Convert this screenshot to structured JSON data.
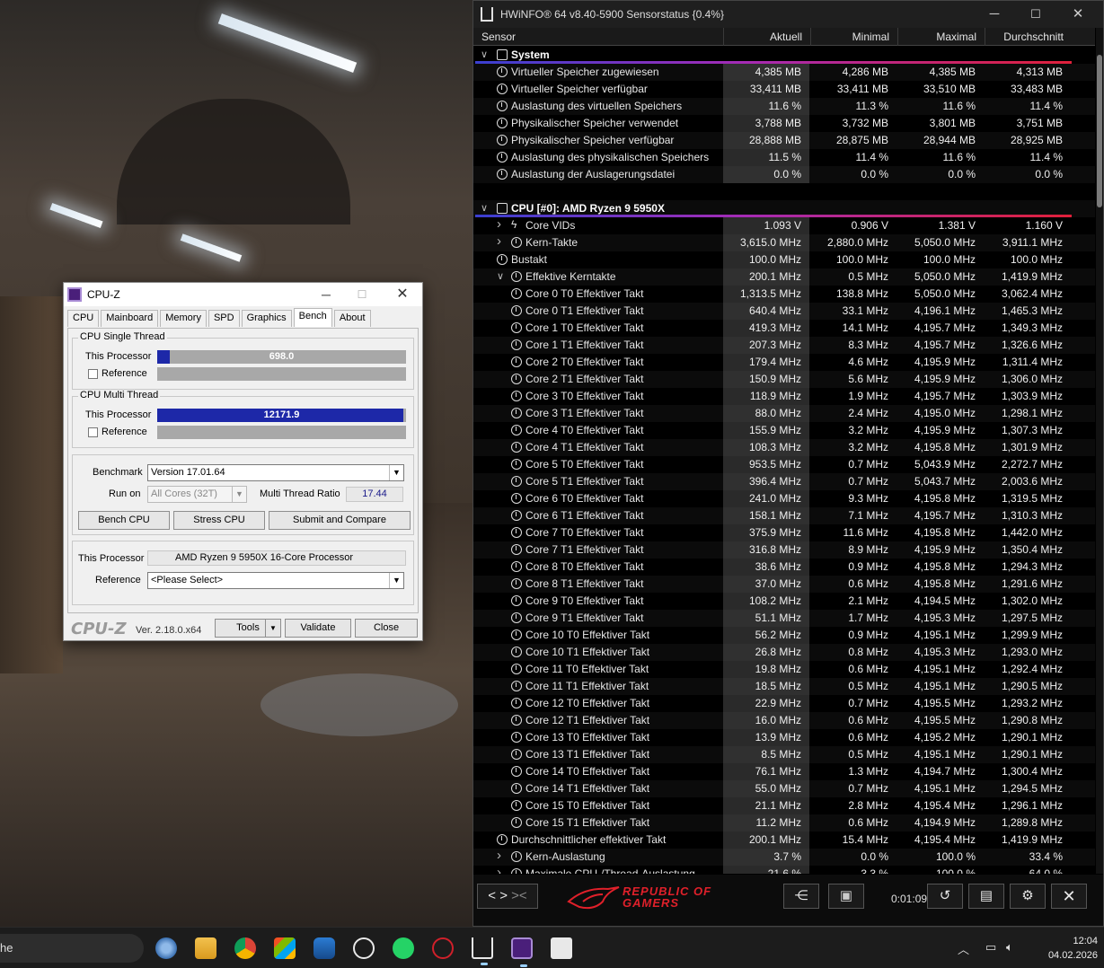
{
  "cpuz": {
    "title": "CPU-Z",
    "tabs": [
      "CPU",
      "Mainboard",
      "Memory",
      "SPD",
      "Graphics",
      "Bench",
      "About"
    ],
    "active_tab": "Bench",
    "single_thread": {
      "group_title": "CPU Single Thread",
      "this_label": "This Processor",
      "value": "698.0",
      "fill": 0.05,
      "reference_label": "Reference"
    },
    "multi_thread": {
      "group_title": "CPU Multi Thread",
      "this_label": "This Processor",
      "value": "12171.9",
      "fill": 0.99,
      "reference_label": "Reference"
    },
    "benchmark_label": "Benchmark",
    "benchmark_value": "Version 17.01.64",
    "run_on_label": "Run on",
    "run_on_value": "All Cores (32T)",
    "mt_ratio_label": "Multi Thread Ratio",
    "mt_ratio_value": "17.44",
    "btn_bench": "Bench CPU",
    "btn_stress": "Stress CPU",
    "btn_submit": "Submit and Compare",
    "this_processor_label": "This Processor",
    "this_processor_value": "AMD Ryzen 9 5950X 16-Core Processor",
    "reference_label": "Reference",
    "reference_value": "<Please Select>",
    "logo": "CPU-Z",
    "version": "Ver. 2.18.0.x64",
    "btn_tools": "Tools",
    "btn_validate": "Validate",
    "btn_close": "Close"
  },
  "hwinfo": {
    "title": "HWiNFO® 64 v8.40-5900 Sensorstatus {0.4%}",
    "columns": [
      "Sensor",
      "Aktuell",
      "Minimal",
      "Maximal",
      "Durchschnitt"
    ],
    "rows": [
      {
        "kind": "group",
        "label": "System",
        "values": [
          "",
          "",
          "",
          ""
        ]
      },
      {
        "kind": "clock",
        "indent": 1,
        "label": "Virtueller Speicher zugewiesen",
        "values": [
          "4,385 MB",
          "4,286 MB",
          "4,385 MB",
          "4,313 MB"
        ]
      },
      {
        "kind": "clock",
        "indent": 1,
        "label": "Virtueller Speicher verfügbar",
        "values": [
          "33,411 MB",
          "33,411 MB",
          "33,510 MB",
          "33,483 MB"
        ]
      },
      {
        "kind": "clock",
        "indent": 1,
        "label": "Auslastung des virtuellen Speichers",
        "values": [
          "11.6 %",
          "11.3 %",
          "11.6 %",
          "11.4 %"
        ]
      },
      {
        "kind": "clock",
        "indent": 1,
        "label": "Physikalischer Speicher verwendet",
        "values": [
          "3,788 MB",
          "3,732 MB",
          "3,801 MB",
          "3,751 MB"
        ]
      },
      {
        "kind": "clock",
        "indent": 1,
        "label": "Physikalischer Speicher verfügbar",
        "values": [
          "28,888 MB",
          "28,875 MB",
          "28,944 MB",
          "28,925 MB"
        ]
      },
      {
        "kind": "clock",
        "indent": 1,
        "label": "Auslastung des physikalischen Speichers",
        "values": [
          "11.5 %",
          "11.4 %",
          "11.6 %",
          "11.4 %"
        ]
      },
      {
        "kind": "clock",
        "indent": 1,
        "label": "Auslastung der Auslagerungsdatei",
        "values": [
          "0.0 %",
          "0.0 %",
          "0.0 %",
          "0.0 %"
        ]
      },
      {
        "kind": "blank",
        "label": "",
        "values": [
          "",
          "",
          "",
          ""
        ]
      },
      {
        "kind": "group",
        "label": "CPU [#0]: AMD Ryzen 9 5950X",
        "values": [
          "",
          "",
          "",
          ""
        ]
      },
      {
        "kind": "bolt",
        "indent": 2,
        "expand": "collapsed",
        "label": "Core VIDs",
        "values": [
          "1.093 V",
          "0.906 V",
          "1.381 V",
          "1.160 V"
        ]
      },
      {
        "kind": "clock",
        "indent": 2,
        "expand": "collapsed",
        "label": "Kern-Takte",
        "values": [
          "3,615.0 MHz",
          "2,880.0 MHz",
          "5,050.0 MHz",
          "3,911.1 MHz"
        ]
      },
      {
        "kind": "clock",
        "indent": 1,
        "label": "Bustakt",
        "values": [
          "100.0 MHz",
          "100.0 MHz",
          "100.0 MHz",
          "100.0 MHz"
        ]
      },
      {
        "kind": "clock",
        "indent": 2,
        "expand": "expanded",
        "label": "Effektive Kerntakte",
        "values": [
          "200.1 MHz",
          "0.5 MHz",
          "5,050.0 MHz",
          "1,419.9 MHz"
        ]
      },
      {
        "kind": "clock",
        "indent": 3,
        "label": "Core 0 T0 Effektiver Takt",
        "values": [
          "1,313.5 MHz",
          "138.8 MHz",
          "5,050.0 MHz",
          "3,062.4 MHz"
        ]
      },
      {
        "kind": "clock",
        "indent": 3,
        "label": "Core 0 T1 Effektiver Takt",
        "values": [
          "640.4 MHz",
          "33.1 MHz",
          "4,196.1 MHz",
          "1,465.3 MHz"
        ]
      },
      {
        "kind": "clock",
        "indent": 3,
        "label": "Core 1 T0 Effektiver Takt",
        "values": [
          "419.3 MHz",
          "14.1 MHz",
          "4,195.7 MHz",
          "1,349.3 MHz"
        ]
      },
      {
        "kind": "clock",
        "indent": 3,
        "label": "Core 1 T1 Effektiver Takt",
        "values": [
          "207.3 MHz",
          "8.3 MHz",
          "4,195.7 MHz",
          "1,326.6 MHz"
        ]
      },
      {
        "kind": "clock",
        "indent": 3,
        "label": "Core 2 T0 Effektiver Takt",
        "values": [
          "179.4 MHz",
          "4.6 MHz",
          "4,195.9 MHz",
          "1,311.4 MHz"
        ]
      },
      {
        "kind": "clock",
        "indent": 3,
        "label": "Core 2 T1 Effektiver Takt",
        "values": [
          "150.9 MHz",
          "5.6 MHz",
          "4,195.9 MHz",
          "1,306.0 MHz"
        ]
      },
      {
        "kind": "clock",
        "indent": 3,
        "label": "Core 3 T0 Effektiver Takt",
        "values": [
          "118.9 MHz",
          "1.9 MHz",
          "4,195.7 MHz",
          "1,303.9 MHz"
        ]
      },
      {
        "kind": "clock",
        "indent": 3,
        "label": "Core 3 T1 Effektiver Takt",
        "values": [
          "88.0 MHz",
          "2.4 MHz",
          "4,195.0 MHz",
          "1,298.1 MHz"
        ]
      },
      {
        "kind": "clock",
        "indent": 3,
        "label": "Core 4 T0 Effektiver Takt",
        "values": [
          "155.9 MHz",
          "3.2 MHz",
          "4,195.9 MHz",
          "1,307.3 MHz"
        ]
      },
      {
        "kind": "clock",
        "indent": 3,
        "label": "Core 4 T1 Effektiver Takt",
        "values": [
          "108.3 MHz",
          "3.2 MHz",
          "4,195.8 MHz",
          "1,301.9 MHz"
        ]
      },
      {
        "kind": "clock",
        "indent": 3,
        "label": "Core 5 T0 Effektiver Takt",
        "values": [
          "953.5 MHz",
          "0.7 MHz",
          "5,043.9 MHz",
          "2,272.7 MHz"
        ]
      },
      {
        "kind": "clock",
        "indent": 3,
        "label": "Core 5 T1 Effektiver Takt",
        "values": [
          "396.4 MHz",
          "0.7 MHz",
          "5,043.7 MHz",
          "2,003.6 MHz"
        ]
      },
      {
        "kind": "clock",
        "indent": 3,
        "label": "Core 6 T0 Effektiver Takt",
        "values": [
          "241.0 MHz",
          "9.3 MHz",
          "4,195.8 MHz",
          "1,319.5 MHz"
        ]
      },
      {
        "kind": "clock",
        "indent": 3,
        "label": "Core 6 T1 Effektiver Takt",
        "values": [
          "158.1 MHz",
          "7.1 MHz",
          "4,195.7 MHz",
          "1,310.3 MHz"
        ]
      },
      {
        "kind": "clock",
        "indent": 3,
        "label": "Core 7 T0 Effektiver Takt",
        "values": [
          "375.9 MHz",
          "11.6 MHz",
          "4,195.8 MHz",
          "1,442.0 MHz"
        ]
      },
      {
        "kind": "clock",
        "indent": 3,
        "label": "Core 7 T1 Effektiver Takt",
        "values": [
          "316.8 MHz",
          "8.9 MHz",
          "4,195.9 MHz",
          "1,350.4 MHz"
        ]
      },
      {
        "kind": "clock",
        "indent": 3,
        "label": "Core 8 T0 Effektiver Takt",
        "values": [
          "38.6 MHz",
          "0.9 MHz",
          "4,195.8 MHz",
          "1,294.3 MHz"
        ]
      },
      {
        "kind": "clock",
        "indent": 3,
        "label": "Core 8 T1 Effektiver Takt",
        "values": [
          "37.0 MHz",
          "0.6 MHz",
          "4,195.8 MHz",
          "1,291.6 MHz"
        ]
      },
      {
        "kind": "clock",
        "indent": 3,
        "label": "Core 9 T0 Effektiver Takt",
        "values": [
          "108.2 MHz",
          "2.1 MHz",
          "4,194.5 MHz",
          "1,302.0 MHz"
        ]
      },
      {
        "kind": "clock",
        "indent": 3,
        "label": "Core 9 T1 Effektiver Takt",
        "values": [
          "51.1 MHz",
          "1.7 MHz",
          "4,195.3 MHz",
          "1,297.5 MHz"
        ]
      },
      {
        "kind": "clock",
        "indent": 3,
        "label": "Core 10 T0 Effektiver Takt",
        "values": [
          "56.2 MHz",
          "0.9 MHz",
          "4,195.1 MHz",
          "1,299.9 MHz"
        ]
      },
      {
        "kind": "clock",
        "indent": 3,
        "label": "Core 10 T1 Effektiver Takt",
        "values": [
          "26.8 MHz",
          "0.8 MHz",
          "4,195.3 MHz",
          "1,293.0 MHz"
        ]
      },
      {
        "kind": "clock",
        "indent": 3,
        "label": "Core 11 T0 Effektiver Takt",
        "values": [
          "19.8 MHz",
          "0.6 MHz",
          "4,195.1 MHz",
          "1,292.4 MHz"
        ]
      },
      {
        "kind": "clock",
        "indent": 3,
        "label": "Core 11 T1 Effektiver Takt",
        "values": [
          "18.5 MHz",
          "0.5 MHz",
          "4,195.1 MHz",
          "1,290.5 MHz"
        ]
      },
      {
        "kind": "clock",
        "indent": 3,
        "label": "Core 12 T0 Effektiver Takt",
        "values": [
          "22.9 MHz",
          "0.7 MHz",
          "4,195.5 MHz",
          "1,293.2 MHz"
        ]
      },
      {
        "kind": "clock",
        "indent": 3,
        "label": "Core 12 T1 Effektiver Takt",
        "values": [
          "16.0 MHz",
          "0.6 MHz",
          "4,195.5 MHz",
          "1,290.8 MHz"
        ]
      },
      {
        "kind": "clock",
        "indent": 3,
        "label": "Core 13 T0 Effektiver Takt",
        "values": [
          "13.9 MHz",
          "0.6 MHz",
          "4,195.2 MHz",
          "1,290.1 MHz"
        ]
      },
      {
        "kind": "clock",
        "indent": 3,
        "label": "Core 13 T1 Effektiver Takt",
        "values": [
          "8.5 MHz",
          "0.5 MHz",
          "4,195.1 MHz",
          "1,290.1 MHz"
        ]
      },
      {
        "kind": "clock",
        "indent": 3,
        "label": "Core 14 T0 Effektiver Takt",
        "values": [
          "76.1 MHz",
          "1.3 MHz",
          "4,194.7 MHz",
          "1,300.4 MHz"
        ]
      },
      {
        "kind": "clock",
        "indent": 3,
        "label": "Core 14 T1 Effektiver Takt",
        "values": [
          "55.0 MHz",
          "0.7 MHz",
          "4,195.1 MHz",
          "1,294.5 MHz"
        ]
      },
      {
        "kind": "clock",
        "indent": 3,
        "label": "Core 15 T0 Effektiver Takt",
        "values": [
          "21.1 MHz",
          "2.8 MHz",
          "4,195.4 MHz",
          "1,296.1 MHz"
        ]
      },
      {
        "kind": "clock",
        "indent": 3,
        "label": "Core 15 T1 Effektiver Takt",
        "values": [
          "11.2 MHz",
          "0.6 MHz",
          "4,194.9 MHz",
          "1,289.8 MHz"
        ]
      },
      {
        "kind": "clock",
        "indent": 1,
        "label": "Durchschnittlicher effektiver Takt",
        "values": [
          "200.1 MHz",
          "15.4 MHz",
          "4,195.4 MHz",
          "1,419.9 MHz"
        ]
      },
      {
        "kind": "clock",
        "indent": 2,
        "expand": "collapsed",
        "label": "Kern-Auslastung",
        "values": [
          "3.7 %",
          "0.0 %",
          "100.0 %",
          "33.4 %"
        ]
      },
      {
        "kind": "clock",
        "indent": 2,
        "expand": "collapsed",
        "label": "Maximale CPU-/Thread-Auslastung",
        "values": [
          "21.6 %",
          "3.3 %",
          "100.0 %",
          "64.0 %"
        ]
      }
    ],
    "timer": "0:01:09",
    "rog_line1": "REPUBLIC OF",
    "rog_line2": "GAMERS"
  },
  "taskbar": {
    "search_text": "he",
    "time": "12:04",
    "date": "04.02.2026"
  }
}
